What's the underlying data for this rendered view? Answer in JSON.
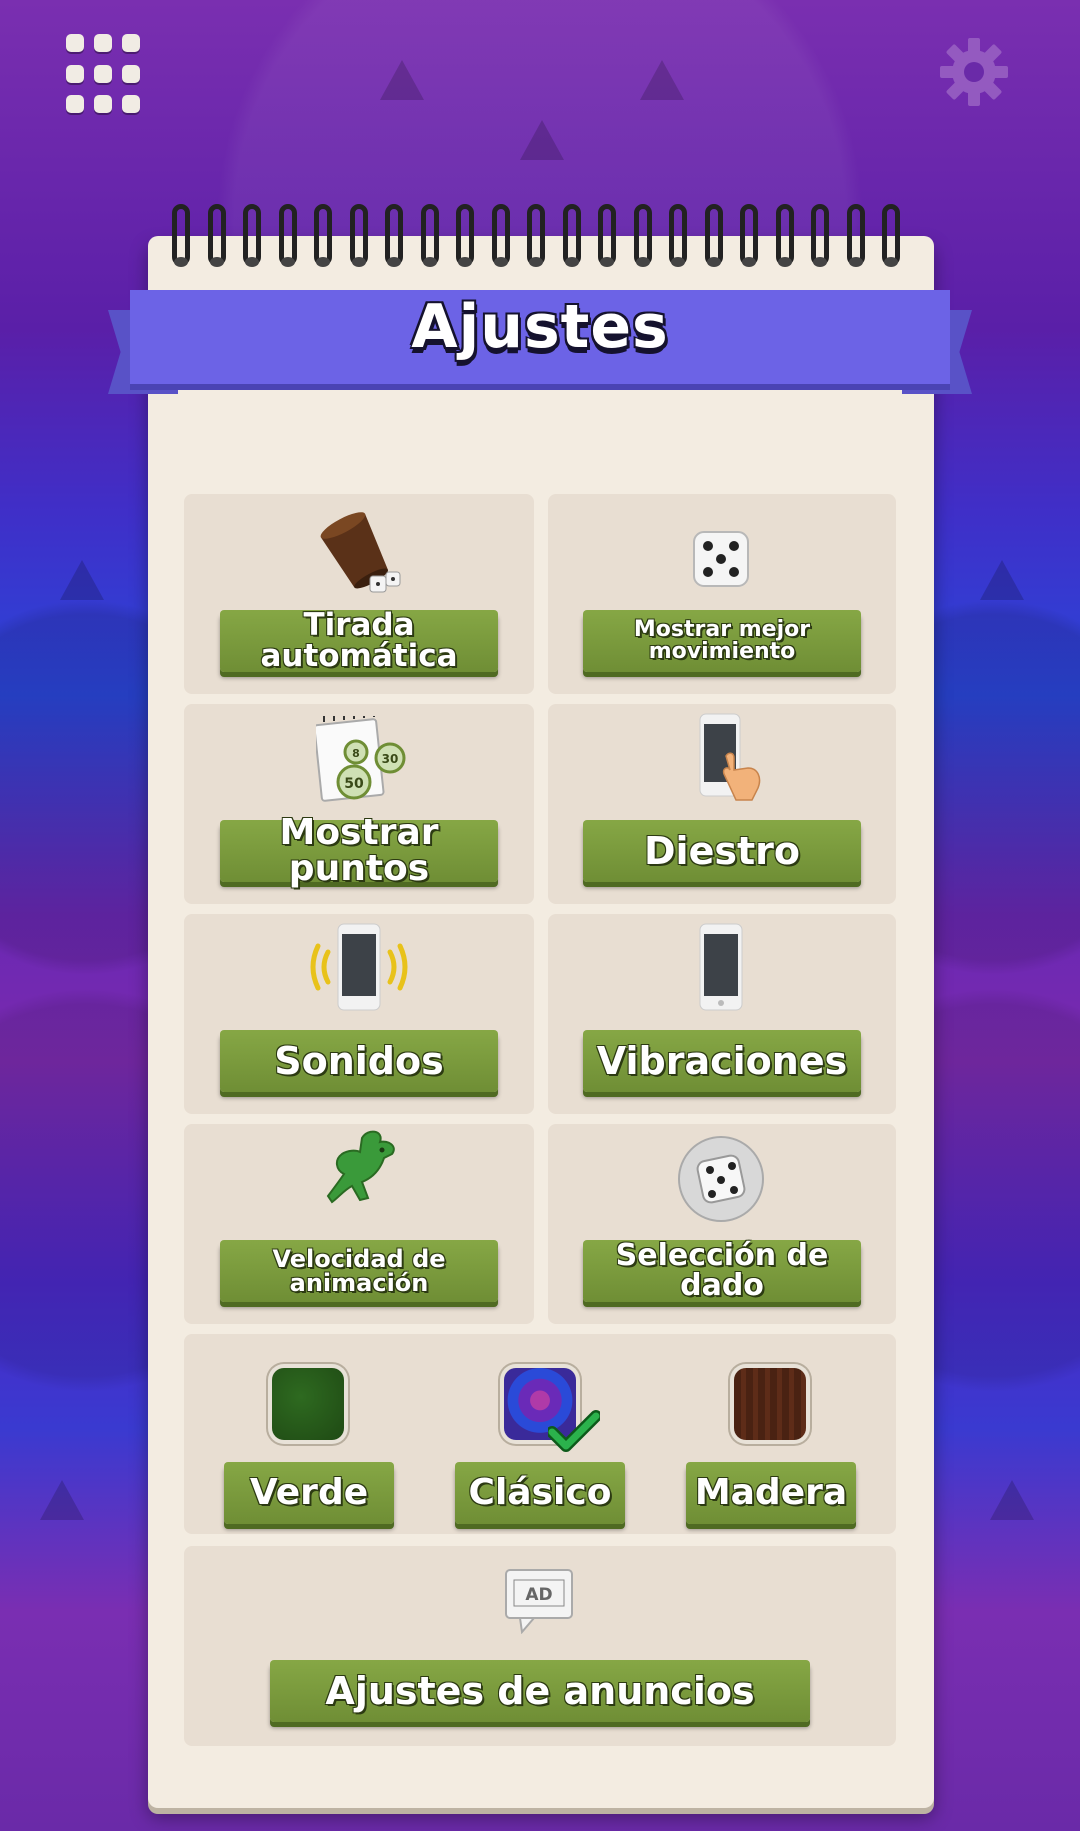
{
  "topbar": {
    "menu_icon": "grid-menu-icon",
    "settings_icon": "gear-icon"
  },
  "page": {
    "title": "Ajustes"
  },
  "settings": {
    "auto_roll": {
      "label": "Tirada automática",
      "icon": "dice-cup-icon"
    },
    "best_move": {
      "label": "Mostrar mejor movimiento",
      "icon": "die-icon"
    },
    "show_points": {
      "label": "Mostrar puntos",
      "icon": "scorecard-icon"
    },
    "handedness": {
      "label": "Diestro",
      "icon": "phone-hand-icon"
    },
    "sounds": {
      "label": "Sonidos",
      "icon": "phone-sound-icon"
    },
    "vibration": {
      "label": "Vibraciones",
      "icon": "phone-icon"
    },
    "anim_speed": {
      "label": "Velocidad de animación",
      "icon": "rabbit-icon"
    },
    "dice_select": {
      "label": "Selección de dado",
      "icon": "die-ball-icon"
    }
  },
  "themes": {
    "selected": "Clásico",
    "options": [
      {
        "label": "Verde",
        "color": "#1f4a14"
      },
      {
        "label": "Clásico",
        "color": "#3a2a9a"
      },
      {
        "label": "Madera",
        "color": "#4a2212"
      }
    ]
  },
  "ads": {
    "label": "Ajustes de anuncios",
    "icon": "ad-icon",
    "icon_text": "AD"
  },
  "colors": {
    "button": "#7a9a3c",
    "banner": "#6c63e6",
    "paper": "#f3ece1",
    "tile": "#e8ded2"
  }
}
